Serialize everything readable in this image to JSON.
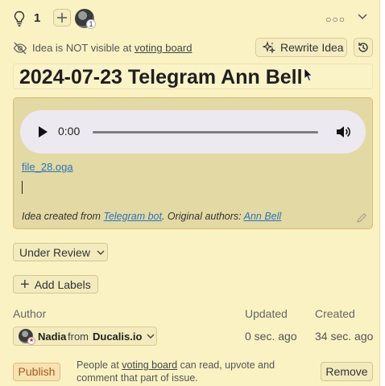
{
  "topbar": {
    "vote_count": "1",
    "voter_badge": "1",
    "more_icon": "more-horizontal-icon"
  },
  "visibility": {
    "text_prefix": "Idea is NOT visible at ",
    "link": "voting board",
    "rewrite_label": "Rewrite Idea"
  },
  "idea": {
    "title": "2024-07-23 Telegram Ann Bell"
  },
  "description": {
    "audio_time": "0:00",
    "file_link": "file_28.oga",
    "created_prefix": "Idea created from ",
    "created_link": "Telegram bot",
    "authors_prefix": ". Original authors: ",
    "authors_link": "Ann Bell"
  },
  "status": {
    "label": "Under Review"
  },
  "labels": {
    "add_label": "Add Labels"
  },
  "meta": {
    "author_header": "Author",
    "updated_header": "Updated",
    "created_header": "Created",
    "author_name": "Nadia",
    "author_from": "from",
    "author_company": "Ducalis.io",
    "updated_value": "0 sec. ago",
    "created_value": "34 sec. ago"
  },
  "publish": {
    "publish_label": "Publish",
    "note_prefix": "People at ",
    "note_link": "voting board",
    "note_suffix": " can read, upvote and comment that part of issue.",
    "remove_label": "Remove"
  },
  "colors": {
    "panel_bg": "#fbf2c4",
    "link": "#2d72b9",
    "publish_text": "#b0541d"
  }
}
